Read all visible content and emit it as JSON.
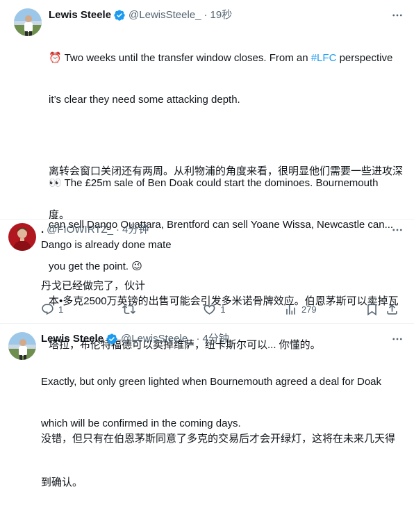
{
  "tweet_main": {
    "name": "Lewis Steele",
    "handle": "@LewisSteele_",
    "time": "19秒",
    "line1_prefix": "⏰ Two weeks until the transfer window closes. From an ",
    "hashtag": "#LFC",
    "line1_suffix": " perspective",
    "line2": "it’s clear they need some attacking depth.",
    "para2_line1": "👀 The £25m sale of Ben Doak could start the dominoes. Bournemouth",
    "para2_line2": "can sell Dango Ouattara, Brentford can sell Yoane Wissa, Newcastle can...",
    "para2_line3": "you get the point. 😉",
    "zh_line1": "离转会窗口关闭还有两周。从利物浦的角度来看，很明显他们需要一些进攻深",
    "zh_line2": "度。",
    "zh_line3": "本•多克2500万英镑的出售可能会引发多米诺骨牌效应。伯恩茅斯可以卖掉瓦",
    "zh_line4": "塔拉，布伦特福德可以卖掉维萨，纽卡斯尔可以... 你懂的。"
  },
  "reply1": {
    "name": ".",
    "handle": "@FIOWIRTZ_",
    "time": "4分钟",
    "text_en": "Dango is already done mate",
    "text_zh": "丹戈已经做完了，伙计",
    "actions": {
      "replies": "1",
      "retweets": "",
      "likes": "1",
      "views": "279"
    }
  },
  "reply2": {
    "name": "Lewis Steele",
    "handle": "@LewisSteele_",
    "time": "4分钟",
    "line1": "Exactly, but only green lighted when Bournemouth agreed a deal for Doak",
    "line2": "which will be confirmed in the coming days.",
    "zh_line1": "没错，但只有在伯恩茅斯同意了多克的交易后才会开绿灯，这将在未来几天得",
    "zh_line2": "到确认。"
  },
  "colors": {
    "accent": "#1d9bf0",
    "text_secondary": "#536471",
    "divider": "#eff3f4"
  },
  "icons": [
    "verified-badge-icon",
    "more-icon",
    "reply-icon",
    "retweet-icon",
    "like-icon",
    "views-icon",
    "bookmark-icon",
    "share-icon"
  ]
}
